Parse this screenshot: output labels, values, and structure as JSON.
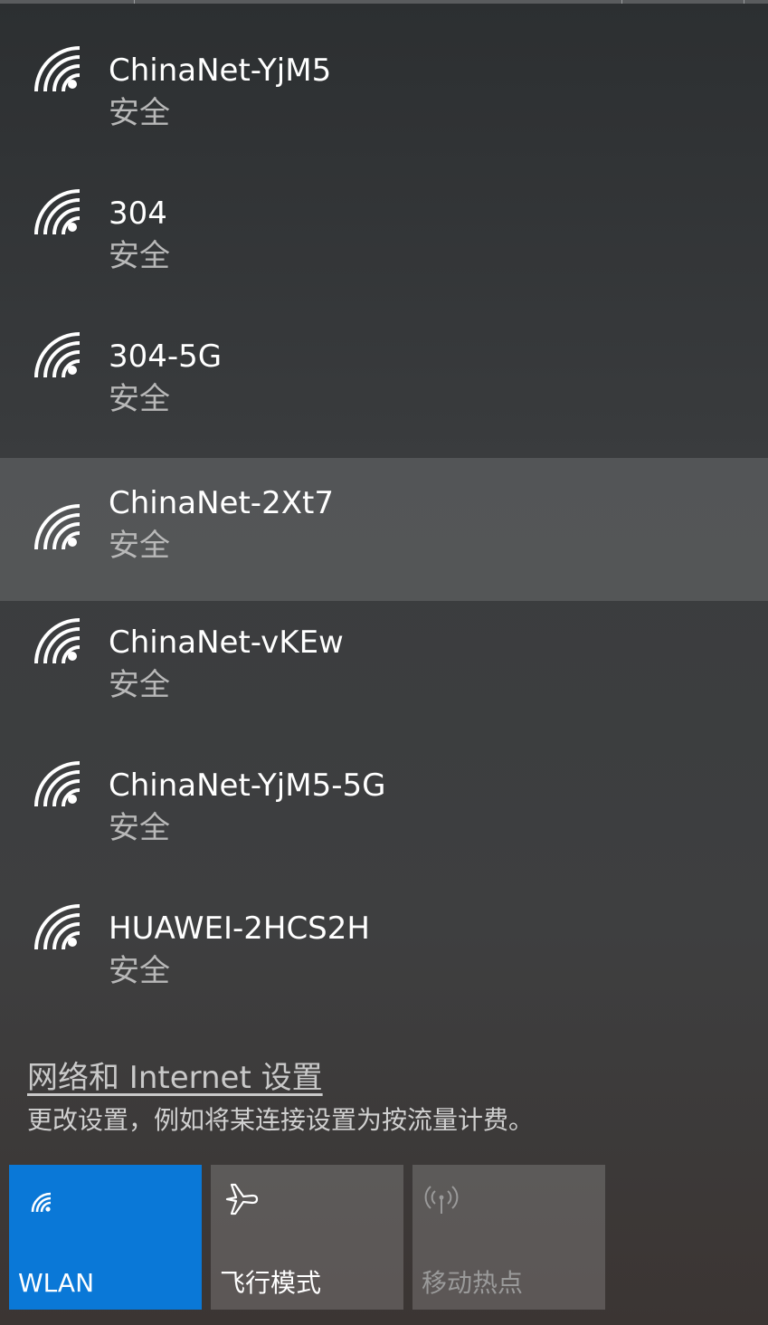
{
  "networks": [
    {
      "ssid": "ChinaNet-YjM5",
      "security": "安全",
      "highlighted": false
    },
    {
      "ssid": "304",
      "security": "安全",
      "highlighted": false
    },
    {
      "ssid": "304-5G",
      "security": "安全",
      "highlighted": false
    },
    {
      "ssid": "ChinaNet-2Xt7",
      "security": "安全",
      "highlighted": true
    },
    {
      "ssid": "ChinaNet-vKEw",
      "security": "安全",
      "highlighted": false
    },
    {
      "ssid": "ChinaNet-YjM5-5G",
      "security": "安全",
      "highlighted": false
    },
    {
      "ssid": "HUAWEI-2HCS2H",
      "security": "安全",
      "highlighted": false
    }
  ],
  "settings": {
    "link": "网络和 Internet 设置",
    "description": "更改设置，例如将某连接设置为按流量计费。"
  },
  "tiles": [
    {
      "label": "WLAN",
      "icon": "wifi-icon",
      "state": "active"
    },
    {
      "label": "飞行模式",
      "icon": "airplane-icon",
      "state": "inactive"
    },
    {
      "label": "移动热点",
      "icon": "hotspot-icon",
      "state": "disabled"
    }
  ],
  "colors": {
    "accent": "#0a78d7",
    "text_primary": "#ffffff",
    "text_secondary": "#b8b8b8"
  }
}
